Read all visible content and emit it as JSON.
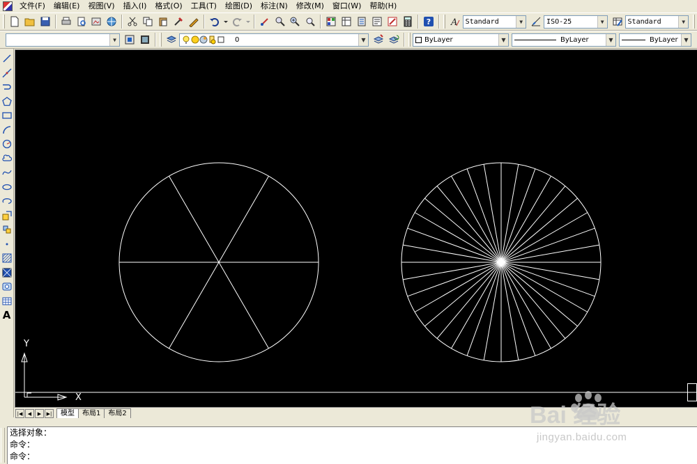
{
  "menubar": {
    "items": [
      {
        "label": "文件(F)"
      },
      {
        "label": "编辑(E)"
      },
      {
        "label": "视图(V)"
      },
      {
        "label": "插入(I)"
      },
      {
        "label": "格式(O)"
      },
      {
        "label": "工具(T)"
      },
      {
        "label": "绘图(D)"
      },
      {
        "label": "标注(N)"
      },
      {
        "label": "修改(M)"
      },
      {
        "label": "窗口(W)"
      },
      {
        "label": "帮助(H)"
      }
    ]
  },
  "styles_toolbar": {
    "text_style": "Standard",
    "dim_style": "ISO-25",
    "table_style": "Standard"
  },
  "layers_toolbar": {
    "workspace": "",
    "current_layer": "0"
  },
  "properties_toolbar": {
    "color": "ByLayer",
    "linetype": "ByLayer",
    "lineweight": "ByLayer"
  },
  "canvas": {
    "background": "#000000",
    "stroke": "#ffffff",
    "ucs": {
      "x_label": "X",
      "y_label": "Y"
    },
    "drawings": [
      {
        "shape": "circle-divided",
        "divisions": 6
      },
      {
        "shape": "circle-divided",
        "divisions": 36
      }
    ]
  },
  "layout_tabs": {
    "tabs": [
      {
        "label": "模型",
        "active": true
      },
      {
        "label": "布局1",
        "active": false
      },
      {
        "label": "布局2",
        "active": false
      }
    ]
  },
  "command_window": {
    "lines": [
      "选择对象：",
      "命令：",
      "命令："
    ]
  },
  "watermark": {
    "logo_text": "Bai 经验",
    "url": "jingyan.baidu.com"
  }
}
